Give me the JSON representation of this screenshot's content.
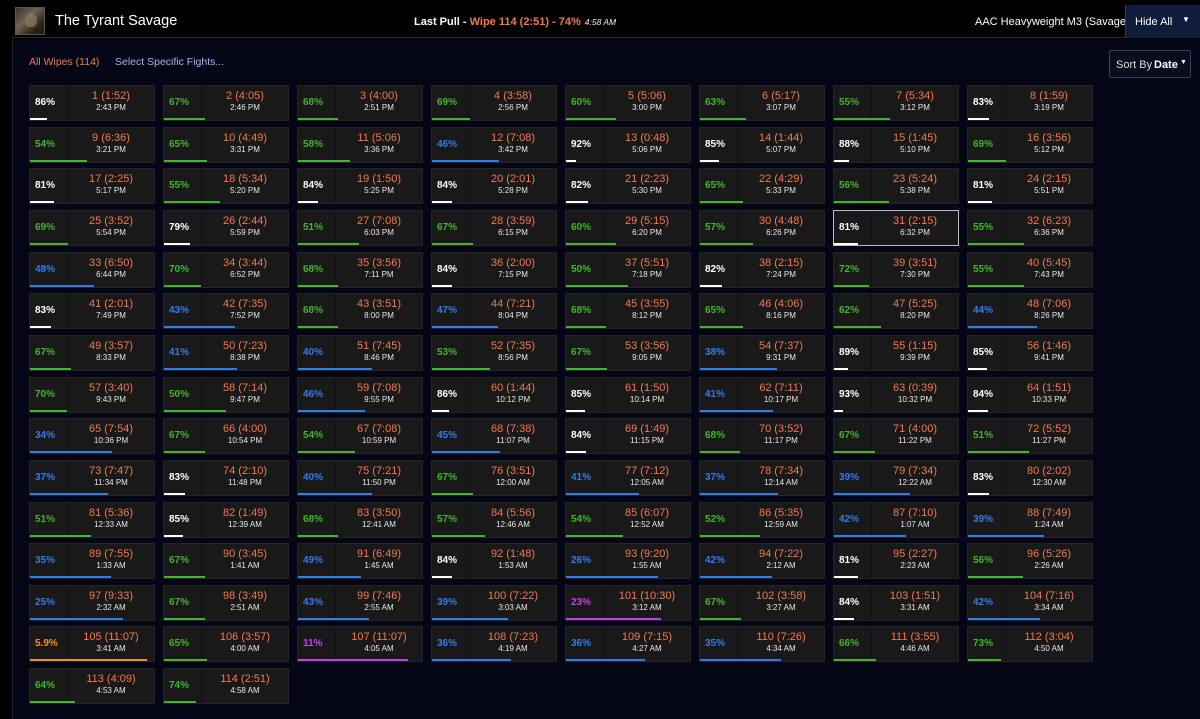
{
  "header": {
    "title": "The Tyrant Savage",
    "last_pull_label": "Last Pull - ",
    "last_pull_wipe": "Wipe 114 (2:51) - 74%",
    "last_pull_time": "4:58 AM",
    "zone": "AAC Heavyweight M3 (Savage)",
    "hide_all_label": "Hide All",
    "avatar_icon": "character-portrait"
  },
  "filters": {
    "all_wipes": "All Wipes (114)",
    "select_specific": "Select Specific Fights..."
  },
  "sort": {
    "label": "Sort By",
    "value": "Date"
  },
  "colors": {
    "white": "#ffffff",
    "green": "#43b42c",
    "blue": "#2f7ded",
    "purple": "#c53ff0",
    "orange": "#f58e2a",
    "wipe_label": "#f2794e"
  },
  "selected_fight": 31,
  "fights": [
    {
      "id": 1,
      "pct": "86%",
      "label": "1 (1:52)",
      "time": "2:43 PM"
    },
    {
      "id": 2,
      "pct": "67%",
      "label": "2 (4:05)",
      "time": "2:46 PM"
    },
    {
      "id": 3,
      "pct": "68%",
      "label": "3 (4:00)",
      "time": "2:51 PM"
    },
    {
      "id": 4,
      "pct": "69%",
      "label": "4 (3:58)",
      "time": "2:56 PM"
    },
    {
      "id": 5,
      "pct": "60%",
      "label": "5 (5:06)",
      "time": "3:00 PM"
    },
    {
      "id": 6,
      "pct": "63%",
      "label": "6 (5:17)",
      "time": "3:07 PM"
    },
    {
      "id": 7,
      "pct": "55%",
      "label": "7 (5:34)",
      "time": "3:12 PM"
    },
    {
      "id": 8,
      "pct": "83%",
      "label": "8 (1:59)",
      "time": "3:19 PM"
    },
    {
      "id": 9,
      "pct": "54%",
      "label": "9 (6:36)",
      "time": "3:21 PM"
    },
    {
      "id": 10,
      "pct": "65%",
      "label": "10 (4:49)",
      "time": "3:31 PM"
    },
    {
      "id": 11,
      "pct": "58%",
      "label": "11 (5:06)",
      "time": "3:36 PM"
    },
    {
      "id": 12,
      "pct": "46%",
      "label": "12 (7:08)",
      "time": "3:42 PM"
    },
    {
      "id": 13,
      "pct": "92%",
      "label": "13 (0:48)",
      "time": "5:06 PM"
    },
    {
      "id": 14,
      "pct": "85%",
      "label": "14 (1:44)",
      "time": "5:07 PM"
    },
    {
      "id": 15,
      "pct": "88%",
      "label": "15 (1:45)",
      "time": "5:10 PM"
    },
    {
      "id": 16,
      "pct": "69%",
      "label": "16 (3:56)",
      "time": "5:12 PM"
    },
    {
      "id": 17,
      "pct": "81%",
      "label": "17 (2:25)",
      "time": "5:17 PM"
    },
    {
      "id": 18,
      "pct": "55%",
      "label": "18 (5:34)",
      "time": "5:20 PM"
    },
    {
      "id": 19,
      "pct": "84%",
      "label": "19 (1:50)",
      "time": "5:25 PM"
    },
    {
      "id": 20,
      "pct": "84%",
      "label": "20 (2:01)",
      "time": "5:28 PM"
    },
    {
      "id": 21,
      "pct": "82%",
      "label": "21 (2:23)",
      "time": "5:30 PM"
    },
    {
      "id": 22,
      "pct": "65%",
      "label": "22 (4:29)",
      "time": "5:33 PM"
    },
    {
      "id": 23,
      "pct": "56%",
      "label": "23 (5:24)",
      "time": "5:38 PM"
    },
    {
      "id": 24,
      "pct": "81%",
      "label": "24 (2:15)",
      "time": "5:51 PM"
    },
    {
      "id": 25,
      "pct": "69%",
      "label": "25 (3:52)",
      "time": "5:54 PM"
    },
    {
      "id": 26,
      "pct": "79%",
      "label": "26 (2:44)",
      "time": "5:59 PM"
    },
    {
      "id": 27,
      "pct": "51%",
      "label": "27 (7:08)",
      "time": "6:03 PM"
    },
    {
      "id": 28,
      "pct": "67%",
      "label": "28 (3:59)",
      "time": "6:15 PM"
    },
    {
      "id": 29,
      "pct": "60%",
      "label": "29 (5:15)",
      "time": "6:20 PM"
    },
    {
      "id": 30,
      "pct": "57%",
      "label": "30 (4:48)",
      "time": "6:26 PM"
    },
    {
      "id": 31,
      "pct": "81%",
      "label": "31 (2:15)",
      "time": "6:32 PM"
    },
    {
      "id": 32,
      "pct": "55%",
      "label": "32 (6:23)",
      "time": "6:36 PM"
    },
    {
      "id": 33,
      "pct": "48%",
      "label": "33 (6:50)",
      "time": "6:44 PM"
    },
    {
      "id": 34,
      "pct": "70%",
      "label": "34 (3:44)",
      "time": "6:52 PM"
    },
    {
      "id": 35,
      "pct": "68%",
      "label": "35 (3:56)",
      "time": "7:11 PM"
    },
    {
      "id": 36,
      "pct": "84%",
      "label": "36 (2:00)",
      "time": "7:15 PM"
    },
    {
      "id": 37,
      "pct": "50%",
      "label": "37 (5:51)",
      "time": "7:18 PM"
    },
    {
      "id": 38,
      "pct": "82%",
      "label": "38 (2:15)",
      "time": "7:24 PM"
    },
    {
      "id": 39,
      "pct": "72%",
      "label": "39 (3:51)",
      "time": "7:30 PM"
    },
    {
      "id": 40,
      "pct": "55%",
      "label": "40 (5:45)",
      "time": "7:43 PM"
    },
    {
      "id": 41,
      "pct": "83%",
      "label": "41 (2:01)",
      "time": "7:49 PM"
    },
    {
      "id": 42,
      "pct": "43%",
      "label": "42 (7:35)",
      "time": "7:52 PM"
    },
    {
      "id": 43,
      "pct": "68%",
      "label": "43 (3:51)",
      "time": "8:00 PM"
    },
    {
      "id": 44,
      "pct": "47%",
      "label": "44 (7:21)",
      "time": "8:04 PM"
    },
    {
      "id": 45,
      "pct": "68%",
      "label": "45 (3:55)",
      "time": "8:12 PM"
    },
    {
      "id": 46,
      "pct": "65%",
      "label": "46 (4:06)",
      "time": "8:16 PM"
    },
    {
      "id": 47,
      "pct": "62%",
      "label": "47 (5:25)",
      "time": "8:20 PM"
    },
    {
      "id": 48,
      "pct": "44%",
      "label": "48 (7:06)",
      "time": "8:26 PM"
    },
    {
      "id": 49,
      "pct": "67%",
      "label": "49 (3:57)",
      "time": "8:33 PM"
    },
    {
      "id": 50,
      "pct": "41%",
      "label": "50 (7:23)",
      "time": "8:38 PM"
    },
    {
      "id": 51,
      "pct": "40%",
      "label": "51 (7:45)",
      "time": "8:46 PM"
    },
    {
      "id": 52,
      "pct": "53%",
      "label": "52 (7:35)",
      "time": "8:56 PM"
    },
    {
      "id": 53,
      "pct": "67%",
      "label": "53 (3:56)",
      "time": "9:05 PM"
    },
    {
      "id": 54,
      "pct": "38%",
      "label": "54 (7:37)",
      "time": "9:31 PM"
    },
    {
      "id": 55,
      "pct": "89%",
      "label": "55 (1:15)",
      "time": "9:39 PM"
    },
    {
      "id": 56,
      "pct": "85%",
      "label": "56 (1:46)",
      "time": "9:41 PM"
    },
    {
      "id": 57,
      "pct": "70%",
      "label": "57 (3:40)",
      "time": "9:43 PM"
    },
    {
      "id": 58,
      "pct": "50%",
      "label": "58 (7:14)",
      "time": "9:47 PM"
    },
    {
      "id": 59,
      "pct": "46%",
      "label": "59 (7:08)",
      "time": "9:55 PM"
    },
    {
      "id": 60,
      "pct": "86%",
      "label": "60 (1:44)",
      "time": "10:12 PM"
    },
    {
      "id": 61,
      "pct": "85%",
      "label": "61 (1:50)",
      "time": "10:14 PM"
    },
    {
      "id": 62,
      "pct": "41%",
      "label": "62 (7:11)",
      "time": "10:17 PM"
    },
    {
      "id": 63,
      "pct": "93%",
      "label": "63 (0:39)",
      "time": "10:32 PM"
    },
    {
      "id": 64,
      "pct": "84%",
      "label": "64 (1:51)",
      "time": "10:33 PM"
    },
    {
      "id": 65,
      "pct": "34%",
      "label": "65 (7:54)",
      "time": "10:36 PM"
    },
    {
      "id": 66,
      "pct": "67%",
      "label": "66 (4:00)",
      "time": "10:54 PM"
    },
    {
      "id": 67,
      "pct": "54%",
      "label": "67 (7:08)",
      "time": "10:59 PM"
    },
    {
      "id": 68,
      "pct": "45%",
      "label": "68 (7:38)",
      "time": "11:07 PM"
    },
    {
      "id": 69,
      "pct": "84%",
      "label": "69 (1:49)",
      "time": "11:15 PM"
    },
    {
      "id": 70,
      "pct": "68%",
      "label": "70 (3:52)",
      "time": "11:17 PM"
    },
    {
      "id": 71,
      "pct": "67%",
      "label": "71 (4:00)",
      "time": "11:22 PM"
    },
    {
      "id": 72,
      "pct": "51%",
      "label": "72 (5:52)",
      "time": "11:27 PM"
    },
    {
      "id": 73,
      "pct": "37%",
      "label": "73 (7:47)",
      "time": "11:34 PM"
    },
    {
      "id": 74,
      "pct": "83%",
      "label": "74 (2:10)",
      "time": "11:48 PM"
    },
    {
      "id": 75,
      "pct": "40%",
      "label": "75 (7:21)",
      "time": "11:50 PM"
    },
    {
      "id": 76,
      "pct": "67%",
      "label": "76 (3:51)",
      "time": "12:00 AM"
    },
    {
      "id": 77,
      "pct": "41%",
      "label": "77 (7:12)",
      "time": "12:05 AM"
    },
    {
      "id": 78,
      "pct": "37%",
      "label": "78 (7:34)",
      "time": "12:14 AM"
    },
    {
      "id": 79,
      "pct": "39%",
      "label": "79 (7:34)",
      "time": "12:22 AM"
    },
    {
      "id": 80,
      "pct": "83%",
      "label": "80 (2:02)",
      "time": "12:30 AM"
    },
    {
      "id": 81,
      "pct": "51%",
      "label": "81 (5:36)",
      "time": "12:33 AM"
    },
    {
      "id": 82,
      "pct": "85%",
      "label": "82 (1:49)",
      "time": "12:39 AM"
    },
    {
      "id": 83,
      "pct": "68%",
      "label": "83 (3:50)",
      "time": "12:41 AM"
    },
    {
      "id": 84,
      "pct": "57%",
      "label": "84 (5:56)",
      "time": "12:46 AM"
    },
    {
      "id": 85,
      "pct": "54%",
      "label": "85 (6:07)",
      "time": "12:52 AM"
    },
    {
      "id": 86,
      "pct": "52%",
      "label": "86 (5:35)",
      "time": "12:59 AM"
    },
    {
      "id": 87,
      "pct": "42%",
      "label": "87 (7:10)",
      "time": "1:07 AM"
    },
    {
      "id": 88,
      "pct": "39%",
      "label": "88 (7:49)",
      "time": "1:24 AM"
    },
    {
      "id": 89,
      "pct": "35%",
      "label": "89 (7:55)",
      "time": "1:33 AM"
    },
    {
      "id": 90,
      "pct": "67%",
      "label": "90 (3:45)",
      "time": "1:41 AM"
    },
    {
      "id": 91,
      "pct": "49%",
      "label": "91 (6:49)",
      "time": "1:45 AM"
    },
    {
      "id": 92,
      "pct": "84%",
      "label": "92 (1:48)",
      "time": "1:53 AM"
    },
    {
      "id": 93,
      "pct": "26%",
      "label": "93 (9:20)",
      "time": "1:55 AM"
    },
    {
      "id": 94,
      "pct": "42%",
      "label": "94 (7:22)",
      "time": "2:12 AM"
    },
    {
      "id": 95,
      "pct": "81%",
      "label": "95 (2:27)",
      "time": "2:23 AM"
    },
    {
      "id": 96,
      "pct": "56%",
      "label": "96 (5:26)",
      "time": "2:26 AM"
    },
    {
      "id": 97,
      "pct": "25%",
      "label": "97 (9:33)",
      "time": "2:32 AM"
    },
    {
      "id": 98,
      "pct": "67%",
      "label": "98 (3:49)",
      "time": "2:51 AM"
    },
    {
      "id": 99,
      "pct": "43%",
      "label": "99 (7:46)",
      "time": "2:55 AM"
    },
    {
      "id": 100,
      "pct": "39%",
      "label": "100 (7:22)",
      "time": "3:03 AM"
    },
    {
      "id": 101,
      "pct": "23%",
      "label": "101 (10:30)",
      "time": "3:12 AM"
    },
    {
      "id": 102,
      "pct": "67%",
      "label": "102 (3:58)",
      "time": "3:27 AM"
    },
    {
      "id": 103,
      "pct": "84%",
      "label": "103 (1:51)",
      "time": "3:31 AM"
    },
    {
      "id": 104,
      "pct": "42%",
      "label": "104 (7:16)",
      "time": "3:34 AM"
    },
    {
      "id": 105,
      "pct": "5.9%",
      "label": "105 (11:07)",
      "time": "3:41 AM"
    },
    {
      "id": 106,
      "pct": "65%",
      "label": "106 (3:57)",
      "time": "4:00 AM"
    },
    {
      "id": 107,
      "pct": "11%",
      "label": "107 (11:07)",
      "time": "4:05 AM"
    },
    {
      "id": 108,
      "pct": "36%",
      "label": "108 (7:23)",
      "time": "4:19 AM"
    },
    {
      "id": 109,
      "pct": "36%",
      "label": "109 (7:15)",
      "time": "4:27 AM"
    },
    {
      "id": 110,
      "pct": "35%",
      "label": "110 (7:26)",
      "time": "4:34 AM"
    },
    {
      "id": 111,
      "pct": "66%",
      "label": "111 (3:55)",
      "time": "4:46 AM"
    },
    {
      "id": 112,
      "pct": "73%",
      "label": "112 (3:04)",
      "time": "4:50 AM"
    },
    {
      "id": 113,
      "pct": "64%",
      "label": "113 (4:09)",
      "time": "4:53 AM"
    },
    {
      "id": 114,
      "pct": "74%",
      "label": "114 (2:51)",
      "time": "4:58 AM"
    }
  ]
}
